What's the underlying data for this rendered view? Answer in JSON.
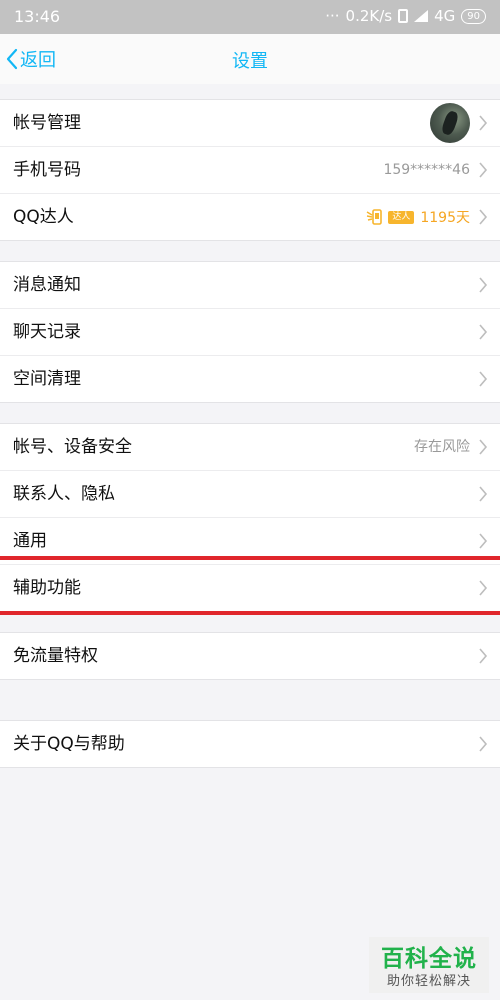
{
  "status_bar": {
    "time": "13:46",
    "dots": "···",
    "speed": "0.2K/s",
    "network": "4G",
    "battery": "90"
  },
  "nav": {
    "back_label": "返回",
    "title": "设置"
  },
  "groups": [
    {
      "items": [
        {
          "label": "帐号管理"
        },
        {
          "label": "手机号码",
          "value": "159******46"
        },
        {
          "label": "QQ达人",
          "badge": "达人",
          "value": "1195天"
        }
      ]
    },
    {
      "items": [
        {
          "label": "消息通知"
        },
        {
          "label": "聊天记录"
        },
        {
          "label": "空间清理"
        }
      ]
    },
    {
      "items": [
        {
          "label": "帐号、设备安全",
          "value": "存在风险"
        },
        {
          "label": "联系人、隐私"
        },
        {
          "label": "通用"
        },
        {
          "label": "辅助功能"
        }
      ]
    },
    {
      "items": [
        {
          "label": "免流量特权"
        }
      ]
    },
    {
      "items": [
        {
          "label": "关于QQ与帮助"
        }
      ]
    }
  ],
  "colors": {
    "accent": "#12b7f5",
    "highlight": "#e0262c",
    "qq_master": "#f5a623"
  },
  "watermark": {
    "main": "百科全说",
    "sub": "助你轻松解决"
  }
}
